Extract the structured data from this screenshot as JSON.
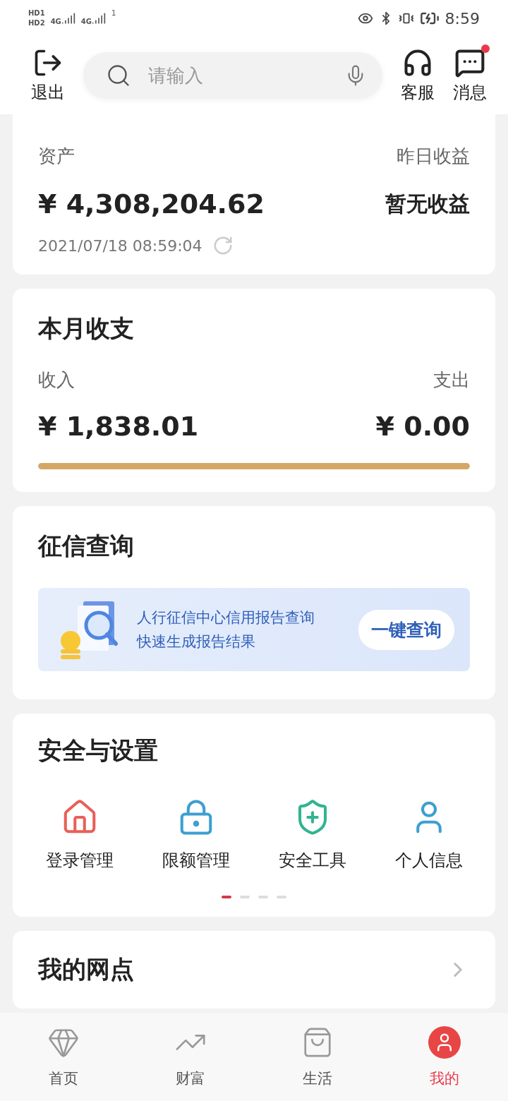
{
  "status_bar": {
    "sims": [
      {
        "label": "HD",
        "slot": "1"
      },
      {
        "label": "HD",
        "slot": "2"
      }
    ],
    "networks": [
      "4G",
      "4G"
    ],
    "hotspot_count": "1",
    "time": "8:59"
  },
  "header": {
    "logout": "退出",
    "search": {
      "placeholder": "请输入"
    },
    "service": "客服",
    "messages": {
      "label": "消息",
      "unread": true
    }
  },
  "assets": {
    "label": "资产",
    "value": "¥ 4,308,204.62",
    "timestamp": "2021/07/18 08:59:04",
    "yesterday_label": "昨日收益",
    "yesterday_value": "暂无收益"
  },
  "monthly": {
    "title": "本月收支",
    "income_label": "收入",
    "income_value": "¥ 1,838.01",
    "expense_label": "支出",
    "expense_value": "¥ 0.00",
    "level": 1
  },
  "credit": {
    "title": "征信查询",
    "lines": [
      "人行征信中心信用报告查询",
      "快速生成报告结果"
    ],
    "button": "一键查询"
  },
  "security": {
    "title": "安全与设置",
    "items": [
      {
        "kind": "home",
        "label": "登录管理",
        "color": "#e8605a"
      },
      {
        "kind": "lock",
        "label": "限额管理",
        "color": "#3d9fd0"
      },
      {
        "kind": "shield",
        "label": "安全工具",
        "color": "#2fb58f"
      },
      {
        "kind": "user",
        "label": "个人信息",
        "color": "#3d9fd0"
      }
    ],
    "pages": [
      {
        "selected": true
      },
      {
        "selected": false
      },
      {
        "selected": false
      },
      {
        "selected": false
      }
    ]
  },
  "branch": {
    "title": "我的网点"
  },
  "nav": [
    {
      "kind": "gem",
      "label": "首页",
      "selected": false
    },
    {
      "kind": "chart",
      "label": "财富",
      "selected": false
    },
    {
      "kind": "bag",
      "label": "生活",
      "selected": false
    },
    {
      "kind": "user",
      "label": "我的",
      "selected": true
    }
  ]
}
